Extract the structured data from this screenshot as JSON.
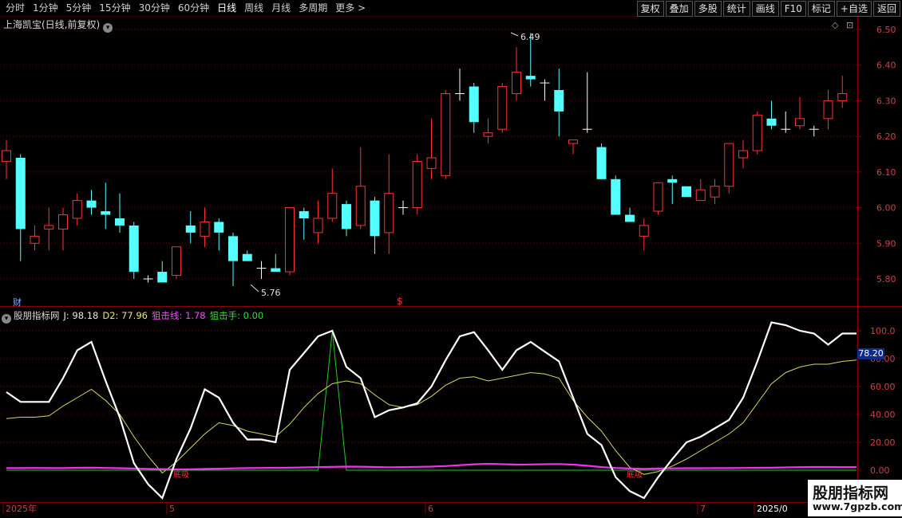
{
  "toolbar": {
    "periods": [
      "分时",
      "1分钟",
      "5分钟",
      "15分钟",
      "30分钟",
      "60分钟",
      "日线",
      "周线",
      "月线",
      "多周期",
      "更多"
    ],
    "active_period": "日线",
    "more_icon": "chevron-right-icon",
    "buttons": [
      "复权",
      "叠加",
      "多股",
      "统计",
      "画线",
      "F10",
      "标记",
      "+自选",
      "返回"
    ]
  },
  "main_chart": {
    "title": "上海凯宝(日线,前复权)",
    "y_ticks": [
      "6.50",
      "6.40",
      "6.30",
      "6.20",
      "6.10",
      "6.00",
      "5.90",
      "5.80"
    ],
    "high_label": "6.49",
    "low_label": "5.76",
    "cai_label": "财",
    "s_marker": "$",
    "colors": {
      "up": "#ff3232",
      "down": "#54ffff",
      "cross": "#ffffff"
    }
  },
  "indicator": {
    "name": "股朋指标网",
    "j_label": "J: 98.18",
    "d2_label": "D2: 77.96",
    "line1_label": "狙击线: 1.78",
    "line2_label": "狙击手: 0.00",
    "y_ticks": [
      "100.0",
      "80.00",
      "60.00",
      "40.00",
      "20.00",
      "0.00"
    ],
    "selected_value": "78.20",
    "buy_labels": [
      "底吸",
      "底吸",
      "底吸"
    ]
  },
  "x_axis": {
    "labels": [
      "2025年",
      "5",
      "6",
      "7",
      "2025/0"
    ]
  },
  "chart_data": {
    "type": "candlestick",
    "title": "上海凯宝(日线,前复权)",
    "candles_ohlc": [
      [
        6.13,
        6.19,
        6.08,
        6.16
      ],
      [
        6.14,
        6.15,
        5.85,
        5.94
      ],
      [
        5.9,
        5.95,
        5.88,
        5.92
      ],
      [
        5.94,
        6.0,
        5.88,
        5.95
      ],
      [
        5.94,
        6.0,
        5.88,
        5.98
      ],
      [
        5.97,
        6.04,
        5.95,
        6.02
      ],
      [
        6.02,
        6.05,
        5.98,
        6.0
      ],
      [
        5.99,
        6.07,
        5.94,
        5.98
      ],
      [
        5.97,
        6.04,
        5.93,
        5.95
      ],
      [
        5.95,
        5.96,
        5.8,
        5.82
      ],
      [
        5.8,
        5.81,
        5.79,
        5.8
      ],
      [
        5.82,
        5.85,
        5.79,
        5.79
      ],
      [
        5.81,
        5.89,
        5.8,
        5.89
      ],
      [
        5.95,
        5.99,
        5.9,
        5.93
      ],
      [
        5.92,
        6.0,
        5.89,
        5.96
      ],
      [
        5.96,
        5.97,
        5.88,
        5.93
      ],
      [
        5.92,
        5.93,
        5.78,
        5.85
      ],
      [
        5.87,
        5.88,
        5.85,
        5.85
      ],
      [
        5.83,
        5.85,
        5.8,
        5.83
      ],
      [
        5.83,
        5.87,
        5.82,
        5.82
      ],
      [
        5.82,
        6.0,
        5.81,
        6.0
      ],
      [
        5.99,
        6.0,
        5.91,
        5.97
      ],
      [
        5.93,
        6.02,
        5.9,
        5.97
      ],
      [
        5.97,
        6.11,
        5.96,
        6.04
      ],
      [
        6.01,
        6.02,
        5.92,
        5.94
      ],
      [
        5.95,
        6.17,
        5.94,
        6.06
      ],
      [
        6.02,
        6.03,
        5.87,
        5.92
      ],
      [
        5.93,
        6.15,
        5.87,
        6.04
      ],
      [
        6.0,
        6.02,
        5.98,
        6.0
      ],
      [
        6.0,
        6.15,
        5.98,
        6.13
      ],
      [
        6.11,
        6.25,
        6.08,
        6.14
      ],
      [
        6.09,
        6.33,
        6.08,
        6.32
      ],
      [
        6.32,
        6.39,
        6.3,
        6.32
      ],
      [
        6.34,
        6.35,
        6.21,
        6.24
      ],
      [
        6.2,
        6.25,
        6.18,
        6.21
      ],
      [
        6.22,
        6.35,
        6.21,
        6.34
      ],
      [
        6.32,
        6.45,
        6.3,
        6.38
      ],
      [
        6.37,
        6.49,
        6.34,
        6.36
      ],
      [
        6.35,
        6.36,
        6.3,
        6.35
      ],
      [
        6.33,
        6.39,
        6.2,
        6.27
      ],
      [
        6.18,
        6.19,
        6.15,
        6.19
      ],
      [
        6.22,
        6.38,
        6.21,
        6.22
      ],
      [
        6.17,
        6.18,
        6.08,
        6.08
      ],
      [
        6.08,
        6.09,
        5.98,
        5.98
      ],
      [
        5.98,
        6.0,
        5.96,
        5.96
      ],
      [
        5.92,
        5.97,
        5.88,
        5.95
      ],
      [
        5.99,
        6.07,
        5.98,
        6.07
      ],
      [
        6.08,
        6.09,
        6.01,
        6.07
      ],
      [
        6.06,
        6.06,
        6.03,
        6.03
      ],
      [
        6.02,
        6.08,
        6.02,
        6.05
      ],
      [
        6.03,
        6.08,
        6.01,
        6.06
      ],
      [
        6.06,
        6.18,
        6.04,
        6.18
      ],
      [
        6.14,
        6.19,
        6.11,
        6.16
      ],
      [
        6.16,
        6.27,
        6.15,
        6.26
      ],
      [
        6.25,
        6.3,
        6.22,
        6.23
      ],
      [
        6.22,
        6.27,
        6.21,
        6.22
      ],
      [
        6.23,
        6.31,
        6.22,
        6.25
      ],
      [
        6.22,
        6.23,
        6.2,
        6.22
      ],
      [
        6.25,
        6.33,
        6.22,
        6.3
      ],
      [
        6.3,
        6.37,
        6.28,
        6.32
      ]
    ],
    "indicator_j": [
      56,
      49,
      49,
      49,
      66,
      86,
      92,
      64,
      38,
      5,
      -10,
      -20,
      8,
      30,
      58,
      52,
      34,
      22,
      22,
      20,
      72,
      84,
      96,
      100,
      74,
      66,
      38,
      43,
      45,
      48,
      60,
      79,
      96,
      99,
      86,
      72,
      86,
      92,
      85,
      78,
      52,
      26,
      18,
      -5,
      -15,
      -20,
      -5,
      8,
      20,
      24,
      30,
      36,
      52,
      78,
      106,
      104,
      100,
      98,
      90,
      98,
      98
    ],
    "indicator_d2": [
      37,
      38,
      38,
      39,
      46,
      52,
      58,
      50,
      40,
      24,
      10,
      -2,
      6,
      16,
      26,
      34,
      32,
      28,
      26,
      24,
      33,
      45,
      55,
      62,
      64,
      62,
      54,
      47,
      45,
      47,
      53,
      61,
      66,
      67,
      64,
      66,
      68,
      70,
      69,
      66,
      50,
      38,
      28,
      14,
      2,
      -3,
      -1,
      3,
      8,
      14,
      20,
      26,
      34,
      48,
      62,
      70,
      74,
      76,
      76,
      78,
      79
    ],
    "indicator_sniper_line": [
      1.5,
      1.5,
      1.6,
      1.5,
      1.5,
      1.7,
      1.8,
      1.6,
      1.4,
      1.2,
      1.0,
      0.8,
      0.6,
      0.7,
      0.9,
      1.1,
      1.3,
      1.5,
      1.6,
      1.7,
      1.8,
      2.0,
      2.2,
      2.4,
      2.6,
      2.5,
      2.3,
      2.1,
      2.2,
      2.4,
      2.6,
      3.0,
      3.6,
      4.2,
      4.6,
      4.3,
      4.0,
      4.1,
      4.3,
      4.4,
      4.0,
      3.2,
      2.2,
      1.6,
      1.2,
      1.0,
      1.2,
      1.3,
      1.4,
      1.4,
      1.5,
      1.5,
      1.6,
      1.7,
      1.8,
      2.0,
      2.2,
      2.3,
      2.3,
      2.2,
      2.2
    ],
    "indicator_sniper_hand": [
      0,
      0,
      0,
      0,
      0,
      0,
      0,
      0,
      0,
      0,
      0,
      0,
      0,
      0,
      0,
      0,
      0,
      0,
      0,
      0,
      0,
      0,
      0,
      100,
      0,
      0,
      0,
      0,
      0,
      0,
      0,
      0,
      0,
      0,
      0,
      0,
      0,
      0,
      0,
      0,
      0,
      0,
      0,
      0,
      0,
      0,
      0,
      0,
      0,
      0,
      0,
      0,
      0,
      0,
      0,
      0,
      0,
      0,
      0,
      0,
      0
    ],
    "price_ylim": [
      5.76,
      6.51
    ],
    "indicator_ylim": [
      -20,
      100
    ]
  }
}
